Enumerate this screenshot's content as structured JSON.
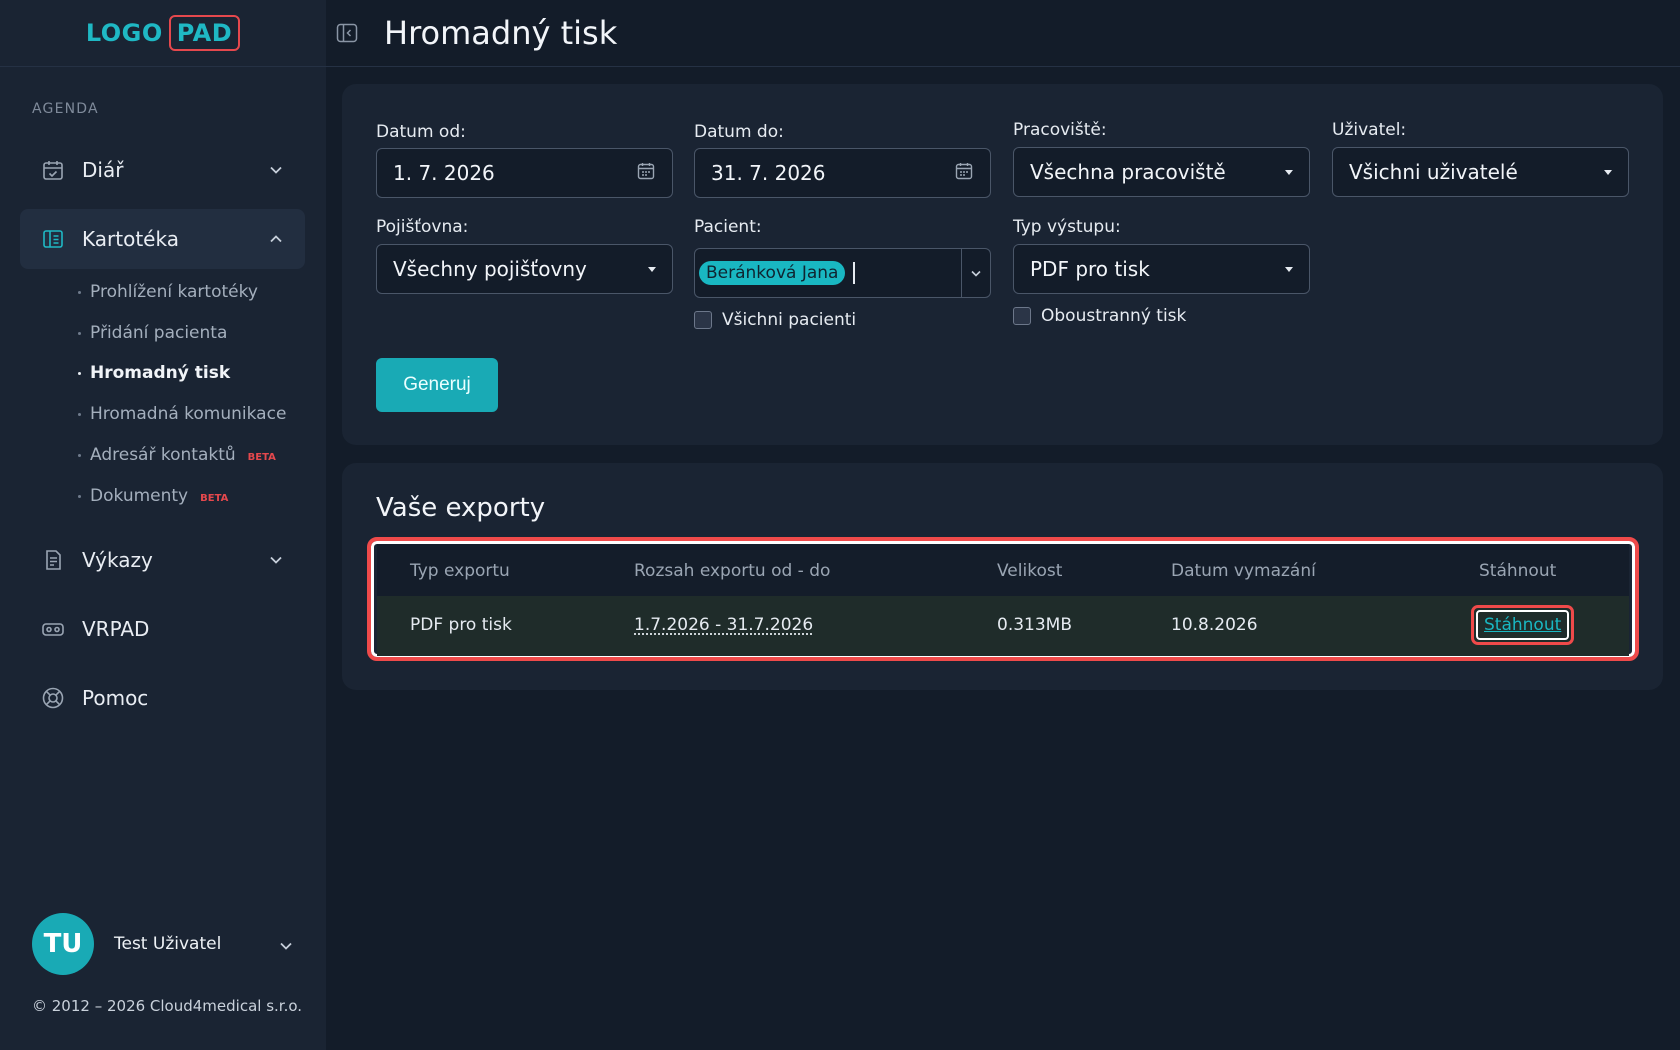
{
  "brand": {
    "logo_left": "LOGO",
    "logo_right": "PAD"
  },
  "header": {
    "title": "Hromadný tisk"
  },
  "sidebar": {
    "section": "AGENDA",
    "items": [
      {
        "label": "Diář",
        "icon": "calendar-check-icon"
      },
      {
        "label": "Kartotéka",
        "icon": "card-file-icon"
      },
      {
        "label": "Výkazy",
        "icon": "report-icon"
      },
      {
        "label": "VRPAD",
        "icon": "vr-headset-icon"
      },
      {
        "label": "Pomoc",
        "icon": "lifebuoy-icon"
      }
    ],
    "subitems": [
      {
        "label": "Prohlížení kartotéky"
      },
      {
        "label": "Přidání pacienta"
      },
      {
        "label": "Hromadný tisk"
      },
      {
        "label": "Hromadná komunikace"
      },
      {
        "label": "Adresář kontaktů",
        "badge": "BETA"
      },
      {
        "label": "Dokumenty",
        "badge": "BETA"
      }
    ],
    "user": {
      "initials": "TU",
      "name": "Test Uživatel"
    },
    "copyright": "© 2012 – 2026 Cloud4medical s.r.o."
  },
  "filters": {
    "date_from": {
      "label": "Datum od:",
      "value": "1. 7. 2026"
    },
    "date_to": {
      "label": "Datum do:",
      "value": "31. 7. 2026"
    },
    "workplace": {
      "label": "Pracoviště:",
      "value": "Všechna pracoviště"
    },
    "user": {
      "label": "Uživatel:",
      "value": "Všichni uživatelé"
    },
    "insurer": {
      "label": "Pojišťovna:",
      "value": "Všechny pojišťovny"
    },
    "patient": {
      "label": "Pacient:",
      "chip": "Beránková Jana"
    },
    "all_patients": "Všichni pacienti",
    "output": {
      "label": "Typ výstupu:",
      "value": "PDF pro tisk"
    },
    "duplex": "Oboustranný tisk",
    "generate": "Generuj"
  },
  "exports": {
    "title": "Vaše exporty",
    "columns": [
      "Typ exportu",
      "Rozsah exportu od - do",
      "Velikost",
      "Datum vymazání",
      "Stáhnout"
    ],
    "rows": [
      {
        "type": "PDF pro tisk",
        "range": "1.7.2026 - 31.7.2026",
        "size": "0.313MB",
        "delete_date": "10.8.2026",
        "download": "Stáhnout"
      }
    ]
  },
  "colors": {
    "accent": "#19aab5",
    "highlight": "#ef4a4a",
    "background": "#131c29",
    "panel": "#1a2433"
  }
}
